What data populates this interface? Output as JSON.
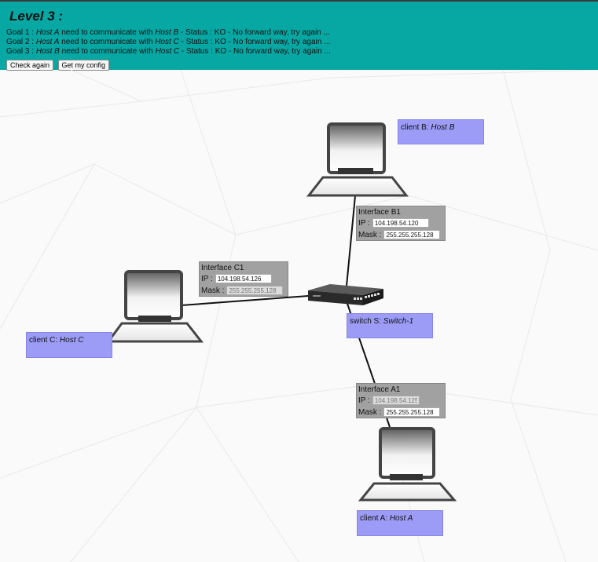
{
  "header": {
    "title": "Level 3 :",
    "goals": [
      {
        "prefix": "Goal 1 : ",
        "from": "Host A",
        "mid": " need to communicate with ",
        "to": "Host B",
        "status": " - Status : KO - No forward way, try again ..."
      },
      {
        "prefix": "Goal 2 : ",
        "from": "Host A",
        "mid": " need to communicate with ",
        "to": "Host C",
        "status": " - Status : KO - No forward way, try again ..."
      },
      {
        "prefix": "Goal 3 : ",
        "from": "Host B",
        "mid": " need to communicate with ",
        "to": "Host C",
        "status": " - Status : KO - No forward way, try again ..."
      }
    ],
    "check_again_label": "Check again",
    "get_config_label": "Get my config"
  },
  "nodes": {
    "client_b": {
      "prefix": "client B: ",
      "name": "Host B"
    },
    "client_c": {
      "prefix": "client C: ",
      "name": "Host C"
    },
    "client_a": {
      "prefix": "client A: ",
      "name": "Host A"
    },
    "switch": {
      "prefix": "switch S: ",
      "name": "Switch-1"
    }
  },
  "interfaces": {
    "b1": {
      "title": "Interface B1",
      "ip_label": "IP :",
      "ip": "104.198.54.120",
      "mask_label": "Mask :",
      "mask": "255.255.255.128"
    },
    "c1": {
      "title": "Interface C1",
      "ip_label": "IP :",
      "ip": "104.198.54.126",
      "mask_label": "Mask :",
      "mask": "255.255.255.128"
    },
    "a1": {
      "title": "Interface A1",
      "ip_label": "IP :",
      "ip": "104.198.54.125",
      "mask_label": "Mask :",
      "mask": "255.255.255.128"
    }
  }
}
